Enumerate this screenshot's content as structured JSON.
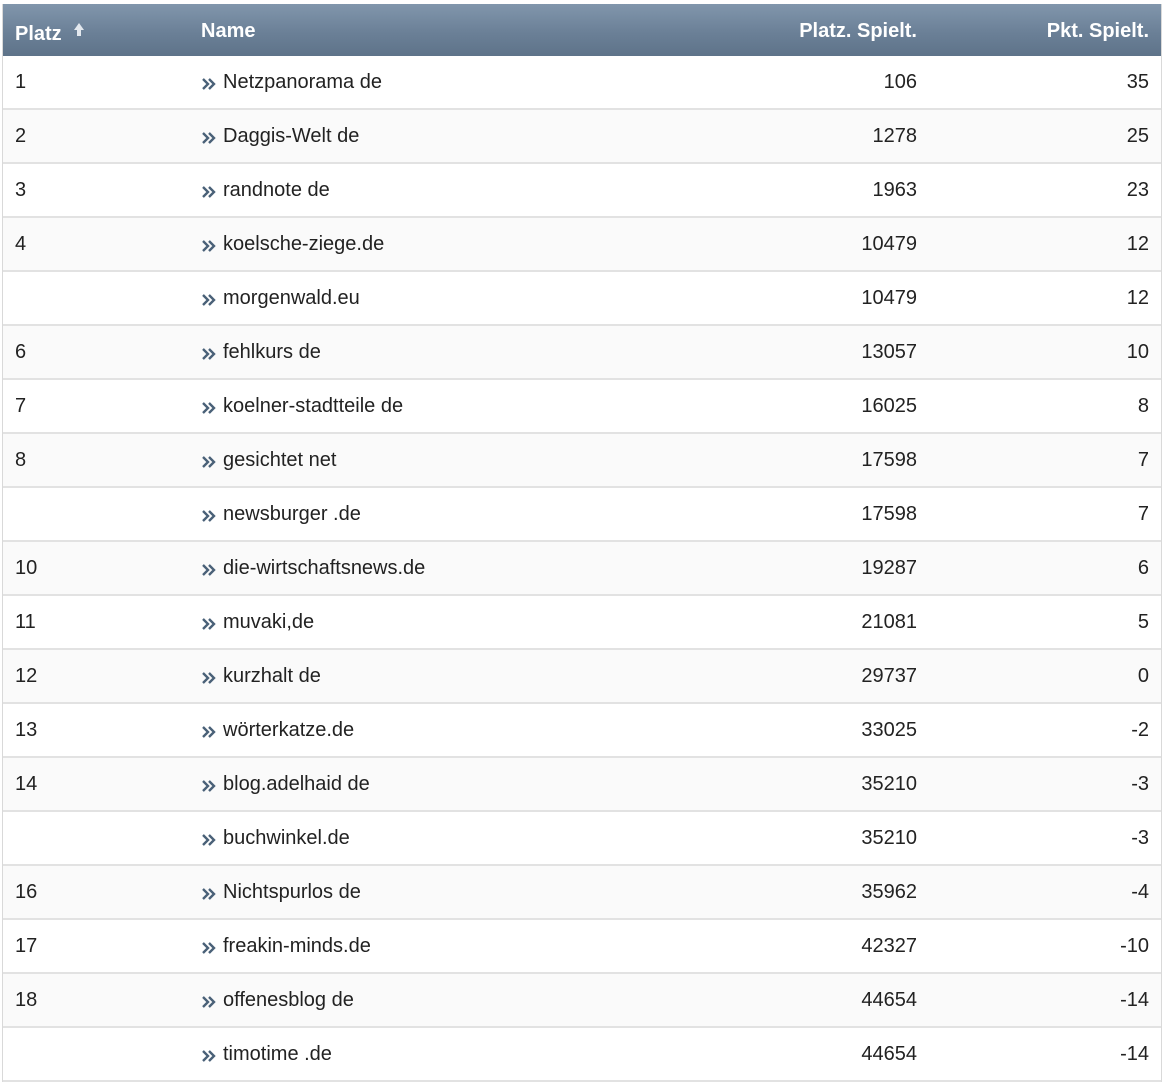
{
  "header": {
    "rank_label": "Platz",
    "name_label": "Name",
    "position_label": "Platz. Spielt.",
    "points_label": "Pkt. Spielt."
  },
  "icons": {
    "sort": "sort-ascending-icon",
    "row_link": "double-chevron-right-icon",
    "chevron_color": "#4a6178"
  },
  "colors": {
    "header_bg": "#6b8097",
    "header_text": "#ffffff",
    "row_border": "#e2e2e2"
  },
  "rows": [
    {
      "rank": "1",
      "name": "Netzpanorama de",
      "position": "106",
      "points": "35"
    },
    {
      "rank": "2",
      "name": "Daggis-Welt de",
      "position": "1278",
      "points": "25"
    },
    {
      "rank": "3",
      "name": "randnote de",
      "position": "1963",
      "points": "23"
    },
    {
      "rank": "4",
      "name": "koelsche-ziege.de",
      "position": "10479",
      "points": "12"
    },
    {
      "rank": "",
      "name": "morgenwald.eu",
      "position": "10479",
      "points": "12"
    },
    {
      "rank": "6",
      "name": "fehlkurs de",
      "position": "13057",
      "points": "10"
    },
    {
      "rank": "7",
      "name": "koelner-stadtteile de",
      "position": "16025",
      "points": "8"
    },
    {
      "rank": "8",
      "name": "gesichtet net",
      "position": "17598",
      "points": "7"
    },
    {
      "rank": "",
      "name": "newsburger .de",
      "position": "17598",
      "points": "7"
    },
    {
      "rank": "10",
      "name": "die-wirtschaftsnews.de",
      "position": "19287",
      "points": "6"
    },
    {
      "rank": "11",
      "name": "muvaki,de",
      "position": "21081",
      "points": "5"
    },
    {
      "rank": "12",
      "name": "kurzhalt de",
      "position": "29737",
      "points": "0"
    },
    {
      "rank": "13",
      "name": "wörterkatze.de",
      "position": "33025",
      "points": "-2"
    },
    {
      "rank": "14",
      "name": "blog.adelhaid de",
      "position": "35210",
      "points": "-3"
    },
    {
      "rank": "",
      "name": "buchwinkel.de",
      "position": "35210",
      "points": "-3"
    },
    {
      "rank": "16",
      "name": "Nichtspurlos de",
      "position": "35962",
      "points": "-4"
    },
    {
      "rank": "17",
      "name": "freakin-minds.de",
      "position": "42327",
      "points": "-10"
    },
    {
      "rank": "18",
      "name": "offenesblog de",
      "position": "44654",
      "points": "-14"
    },
    {
      "rank": "",
      "name": "timotime .de",
      "position": "44654",
      "points": "-14"
    }
  ]
}
